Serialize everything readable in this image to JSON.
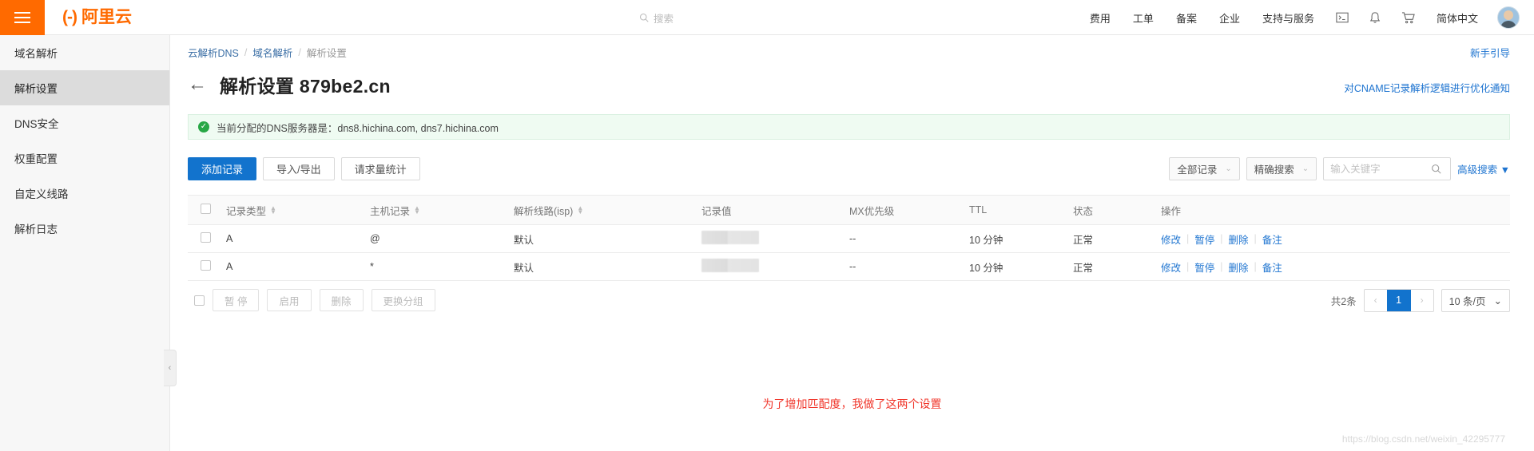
{
  "topbar": {
    "menu_icon": "hamburger-icon",
    "logo_mark": "(-)",
    "logo_text": "阿里云",
    "search_placeholder": "搜索",
    "nav_items": [
      {
        "label": "费用"
      },
      {
        "label": "工单"
      },
      {
        "label": "备案"
      },
      {
        "label": "企业"
      },
      {
        "label": "支持与服务"
      }
    ],
    "icons": [
      {
        "name": "terminal-icon",
        "glyph": "▣"
      },
      {
        "name": "bell-icon",
        "glyph": "🔔"
      },
      {
        "name": "cart-icon",
        "glyph": "🛒"
      }
    ],
    "language": "简体中文"
  },
  "sidebar": {
    "items": [
      {
        "label": "域名解析",
        "active": false
      },
      {
        "label": "解析设置",
        "active": true
      },
      {
        "label": "DNS安全",
        "active": false
      },
      {
        "label": "权重配置",
        "active": false
      },
      {
        "label": "自定义线路",
        "active": false
      },
      {
        "label": "解析日志",
        "active": false
      }
    ],
    "collapse_glyph": "‹"
  },
  "breadcrumb": {
    "item1": "云解析DNS",
    "sep1": "/",
    "item2": "域名解析",
    "sep2": "/",
    "item3": "解析设置"
  },
  "header": {
    "guide_link": "新手引导",
    "back_arrow": "←",
    "title": "解析设置 879be2.cn",
    "cname_link": "对CNAME记录解析逻辑进行优化通知"
  },
  "notice": {
    "icon_glyph": "✓",
    "text": "当前分配的DNS服务器是：dns8.hichina.com, dns7.hichina.com",
    "bg_color": "#effbf2",
    "icon_color": "#27a745"
  },
  "toolbar": {
    "add_record": "添加记录",
    "import_export": "导入/导出",
    "request_stats": "请求量统计",
    "record_filter": "全部记录",
    "search_mode": "精确搜索",
    "search_placeholder": "输入关键字",
    "search_value": "",
    "search_icon": "search-icon",
    "advanced_search": "高级搜索",
    "advanced_caret": "▼",
    "primary_color": "#1273cd"
  },
  "table": {
    "columns": [
      {
        "label": "记录类型",
        "sortable": true
      },
      {
        "label": "主机记录",
        "sortable": true
      },
      {
        "label": "解析线路(isp)",
        "sortable": true
      },
      {
        "label": "记录值",
        "sortable": false
      },
      {
        "label": "MX优先级",
        "sortable": false
      },
      {
        "label": "TTL",
        "sortable": false
      },
      {
        "label": "状态",
        "sortable": false
      },
      {
        "label": "操作",
        "sortable": false
      }
    ],
    "rows": [
      {
        "type": "A",
        "host": "@",
        "line": "默认",
        "value": "",
        "mx": "--",
        "ttl": "10 分钟",
        "status": "正常",
        "actions": [
          "修改",
          "暂停",
          "删除",
          "备注"
        ]
      },
      {
        "type": "A",
        "host": "*",
        "line": "默认",
        "value": "",
        "mx": "--",
        "ttl": "10 分钟",
        "status": "正常",
        "actions": [
          "修改",
          "暂停",
          "删除",
          "备注"
        ]
      }
    ],
    "status_color": "#3a9b48"
  },
  "footer": {
    "bulk_buttons": [
      {
        "label": "暂 停"
      },
      {
        "label": "启用"
      },
      {
        "label": "删除"
      },
      {
        "label": "更换分组"
      }
    ],
    "total": "共2条",
    "prev": "‹",
    "page": "1",
    "next": "›",
    "page_size": "10 条/页",
    "caret": "⌄"
  },
  "annotation": {
    "text": "为了增加匹配度，我做了这两个设置",
    "color": "#f0352a"
  },
  "watermark": {
    "text": "https://blog.csdn.net/weixin_42295777"
  }
}
